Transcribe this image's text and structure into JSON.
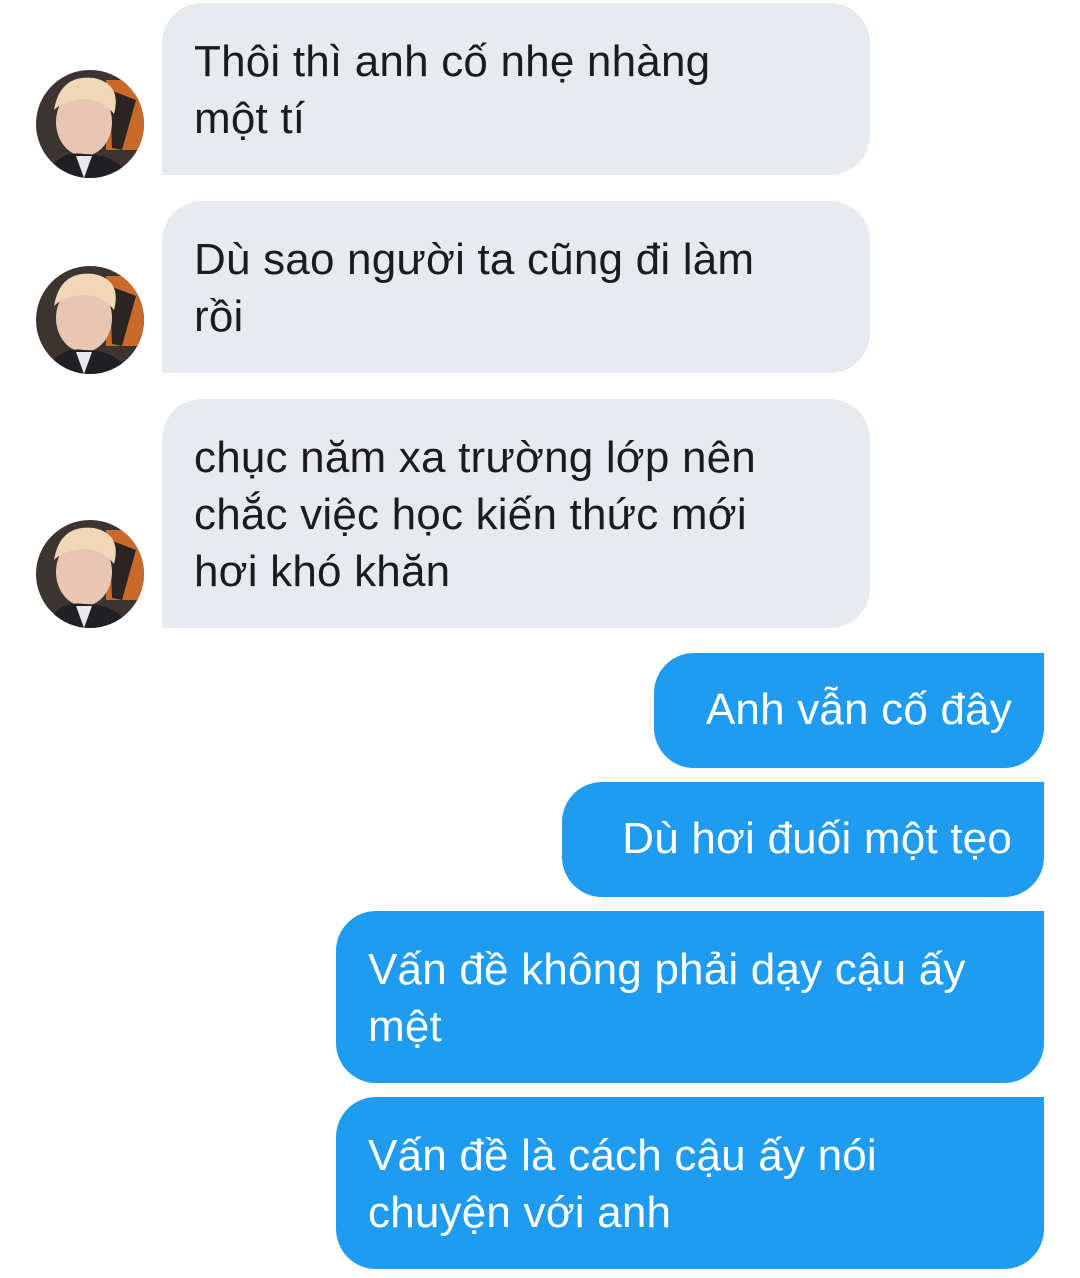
{
  "colors": {
    "received_bubble": "#e7eaee",
    "sent_bubble": "#1f9cf0",
    "received_text": "#1c1c1e",
    "sent_text": "#ffffff"
  },
  "conversation": {
    "received": [
      {
        "text": "Thôi thì anh cố nhẹ nhàng\nmột tí",
        "avatar": "contact-avatar"
      },
      {
        "text": "Dù sao người ta cũng đi làm\nrồi",
        "avatar": "contact-avatar"
      },
      {
        "text": "chục năm xa trường lớp nên\nchắc việc học kiến thức mới\nhơi khó khăn",
        "avatar": "contact-avatar"
      }
    ],
    "sent": [
      {
        "text": "Anh vẫn cố đây"
      },
      {
        "text": "Dù hơi đuối một tẹo"
      },
      {
        "text": "Vấn đề không phải dạy cậu ấy\nmệt"
      },
      {
        "text": "Vấn đề là cách cậu ấy nói\nchuyện với anh"
      }
    ]
  }
}
